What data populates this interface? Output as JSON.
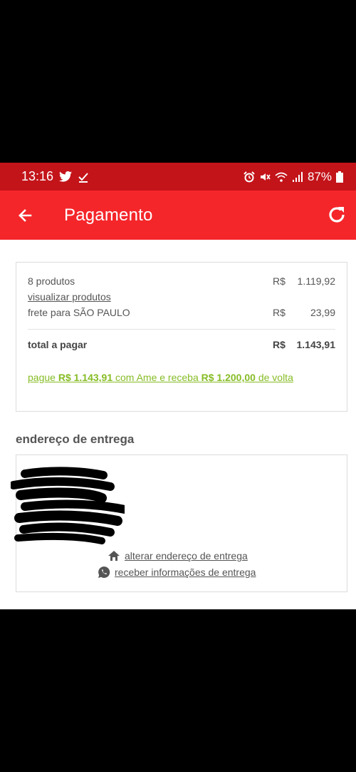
{
  "status_bar": {
    "time": "13:16",
    "battery": "87%",
    "left_icons": [
      "twitter-icon",
      "download-done-icon"
    ],
    "right_icons": [
      "alarm-icon",
      "mute-icon",
      "wifi-icon",
      "signal-icon",
      "battery-icon"
    ]
  },
  "app_bar": {
    "title": "Pagamento",
    "back_icon": "arrow-left-icon",
    "refresh_icon": "refresh-icon"
  },
  "summary": {
    "products_label": "8 produtos",
    "products_currency": "R$",
    "products_amount": "1.119,92",
    "view_products_link": "visualizar produtos",
    "shipping_label": "frete para SÃO PAULO",
    "shipping_currency": "R$",
    "shipping_amount": "23,99",
    "total_label": "total a pagar",
    "total_currency": "R$",
    "total_amount": "1.143,91",
    "promo": {
      "prefix": "pague ",
      "pay_amount": "R$ 1.143,91",
      "middle": " com Ame e receba ",
      "cashback_amount": "R$ 1.200,00",
      "suffix": " de volta"
    }
  },
  "address": {
    "section_title": "endereço de entrega",
    "change_address_link": "alterar endereço de entrega",
    "receive_info_link": "receber informações de entrega"
  },
  "colors": {
    "status_bar": "#c3141a",
    "app_bar": "#f4262a",
    "promo_green": "#86bc25"
  }
}
